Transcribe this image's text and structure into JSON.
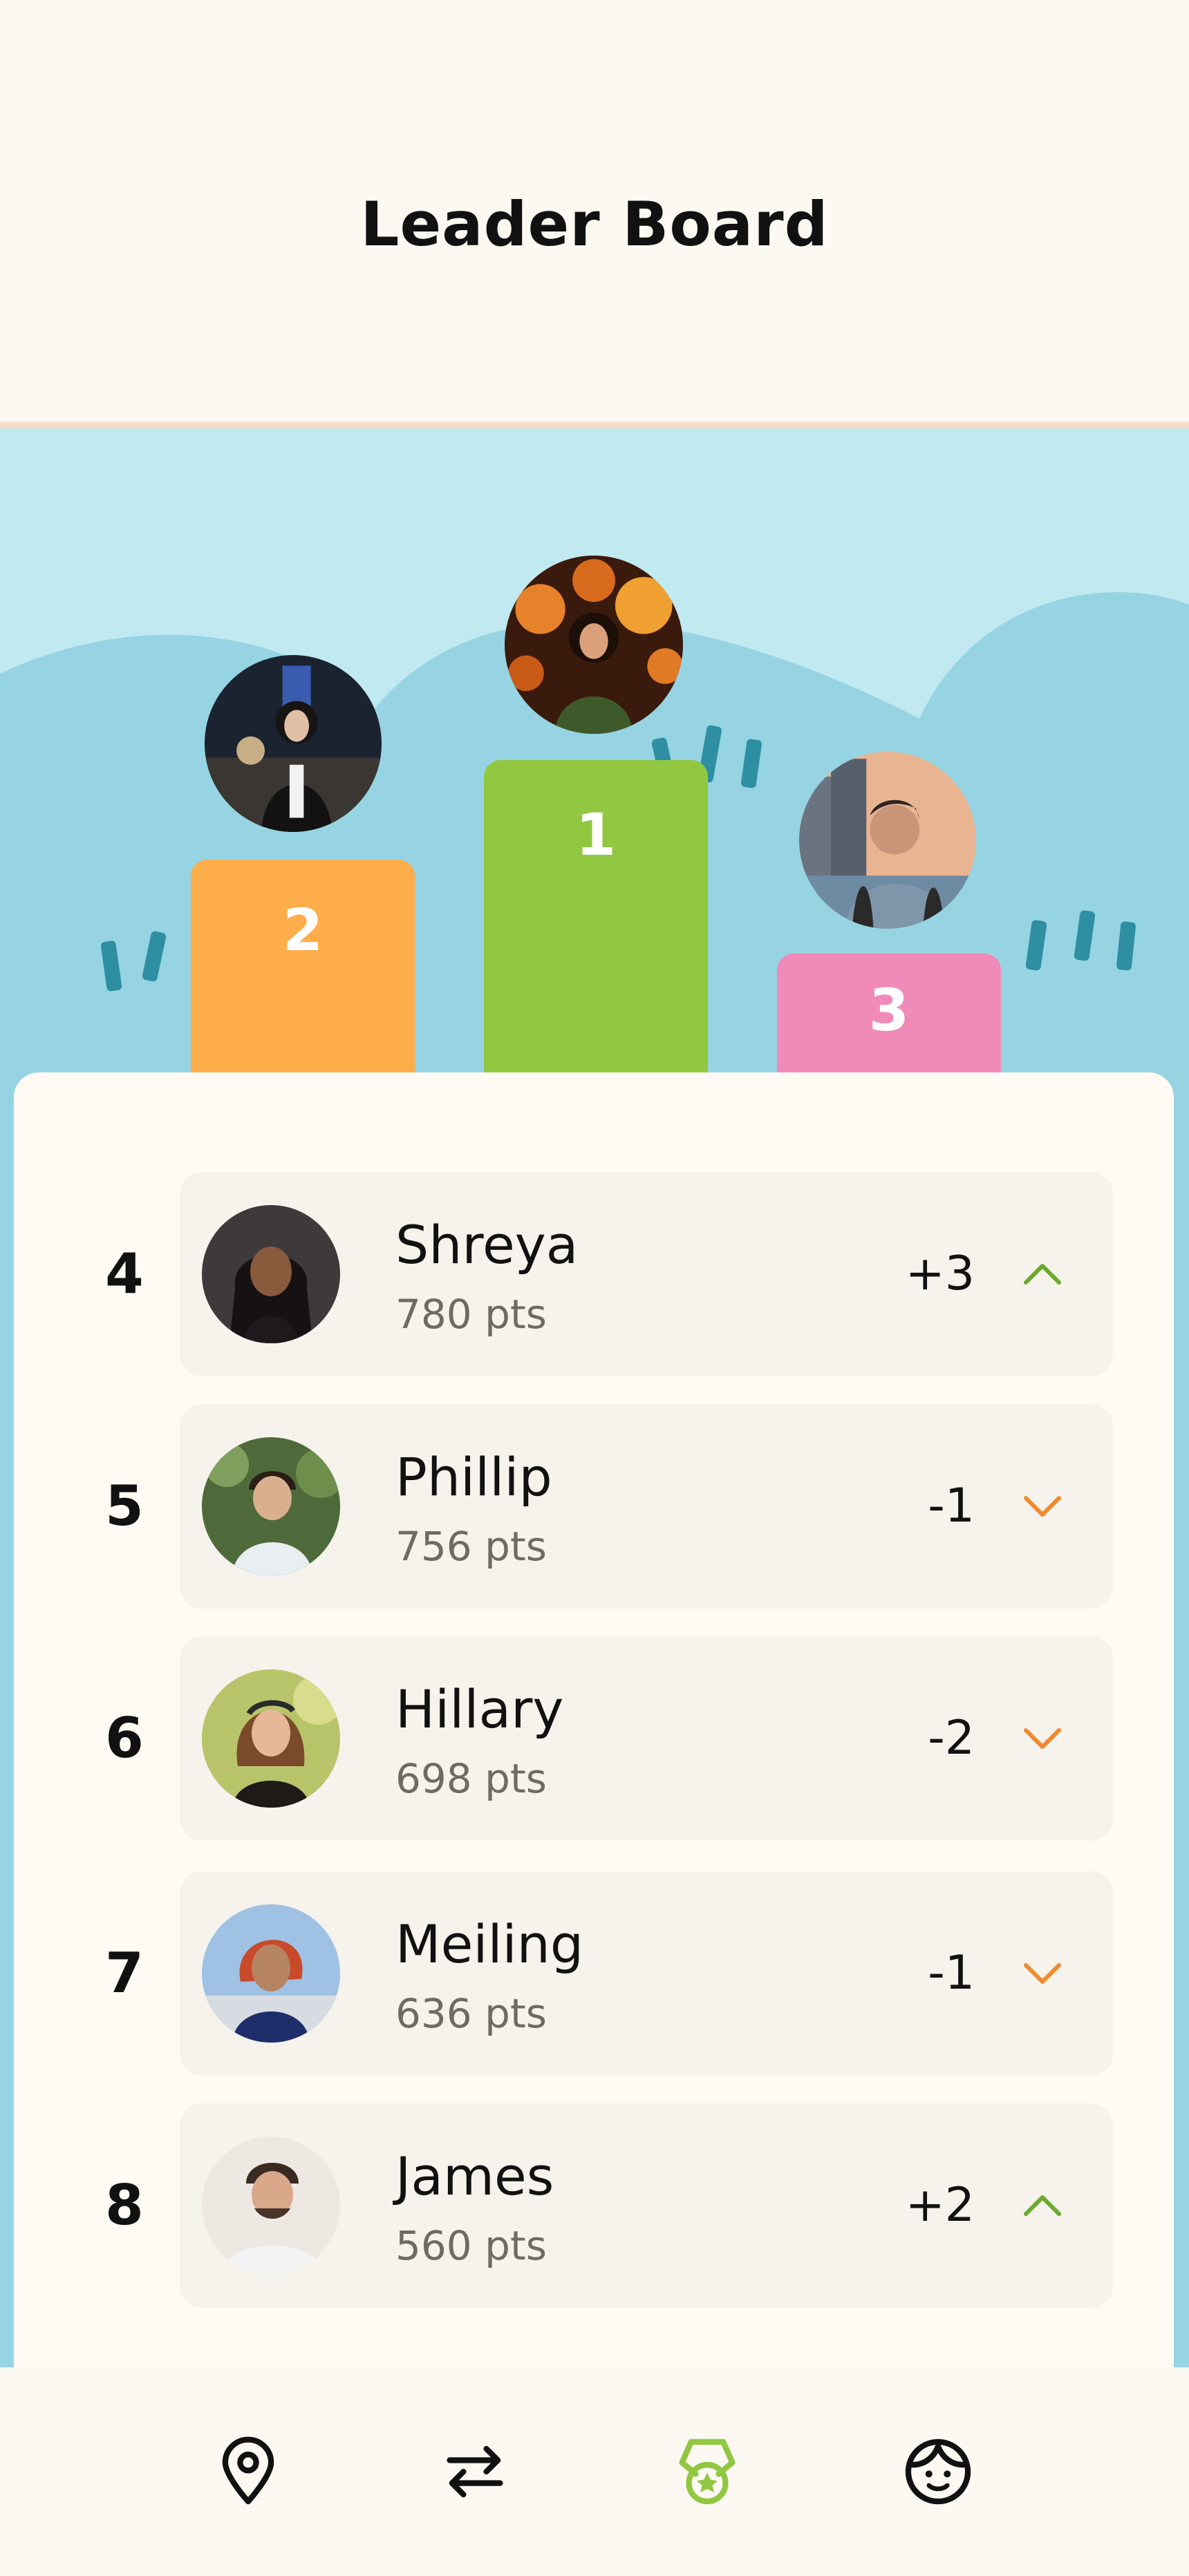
{
  "header": {
    "title": "Leader Board"
  },
  "podium": [
    {
      "rank": "1",
      "person": "first-place",
      "color": "#91C741"
    },
    {
      "rank": "2",
      "person": "second-place",
      "color": "#FFAD4A"
    },
    {
      "rank": "3",
      "person": "third-place",
      "color": "#F08AB8"
    }
  ],
  "leaderboard": [
    {
      "rank": "4",
      "name": "Shreya",
      "points": "780 pts",
      "change": "+3",
      "trend": "up"
    },
    {
      "rank": "5",
      "name": "Phillip",
      "points": "756 pts",
      "change": "-1",
      "trend": "down"
    },
    {
      "rank": "6",
      "name": "Hillary",
      "points": "698 pts",
      "change": "-2",
      "trend": "down"
    },
    {
      "rank": "7",
      "name": "Meiling",
      "points": "636 pts",
      "change": "-1",
      "trend": "down"
    },
    {
      "rank": "8",
      "name": "James",
      "points": "560 pts",
      "change": "+2",
      "trend": "up"
    }
  ],
  "colors": {
    "background": "#FCF8F2",
    "sky": "#C1E9F0",
    "hills": "#96D4E3",
    "accent_dash": "#2E8FA2",
    "trend_up": "#6BAA2E",
    "trend_down": "#F08A2E",
    "nav_active": "#91C741"
  },
  "navbar": {
    "items": [
      {
        "icon": "location-pin-icon",
        "active": false
      },
      {
        "icon": "swap-arrows-icon",
        "active": false
      },
      {
        "icon": "medal-icon",
        "active": true
      },
      {
        "icon": "profile-face-icon",
        "active": false
      }
    ]
  }
}
